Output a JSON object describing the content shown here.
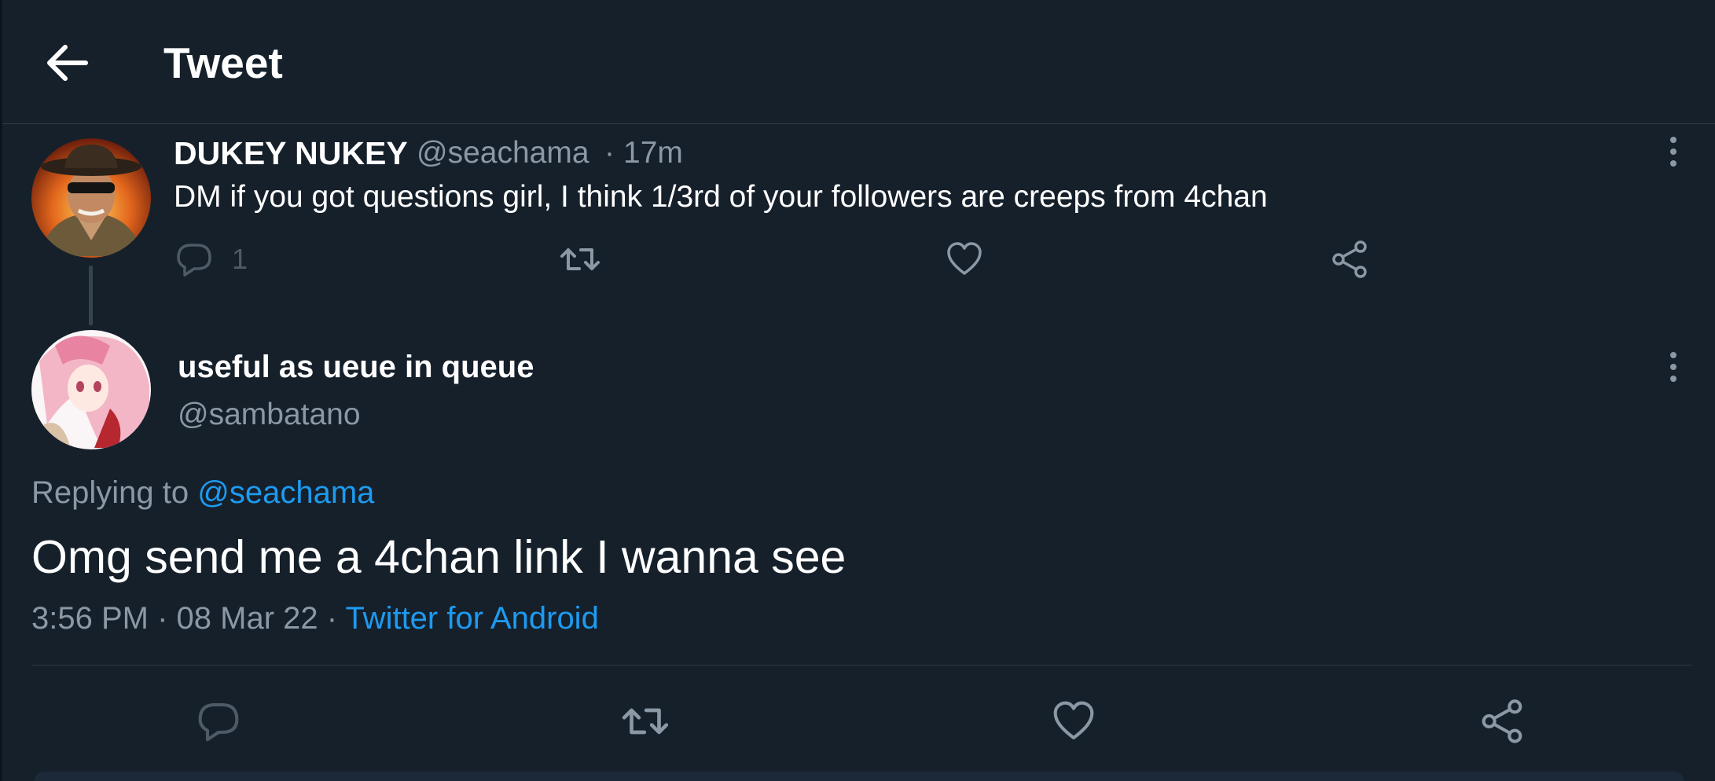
{
  "header": {
    "title": "Tweet"
  },
  "parent_tweet": {
    "display_name": "DUKEY NUKEY",
    "handle": "@seachama",
    "separator": "·",
    "time": "17m",
    "text": "DM if you got questions girl, I think 1/3rd of your followers are creeps from 4chan",
    "reply_count": "1"
  },
  "main_tweet": {
    "display_name": "useful as ueue in queue",
    "handle": "@sambatano",
    "replying_prefix": "Replying to ",
    "replying_to": "@seachama",
    "text": "Omg send me a 4chan link I wanna see",
    "time": "3:56 PM",
    "sep1": " · ",
    "date": "08 Mar 22",
    "sep2": " · ",
    "source": "Twitter for Android"
  },
  "colors": {
    "background": "#16202b",
    "text_primary": "#ffffff",
    "text_secondary": "#8b98a5",
    "accent": "#1d9bf0",
    "divider": "#2f3b47"
  },
  "icons": {
    "back": "arrow-left-icon",
    "more": "more-vertical-icon",
    "reply": "reply-bubble-icon",
    "retweet": "retweet-icon",
    "like": "heart-icon",
    "share": "share-icon"
  }
}
